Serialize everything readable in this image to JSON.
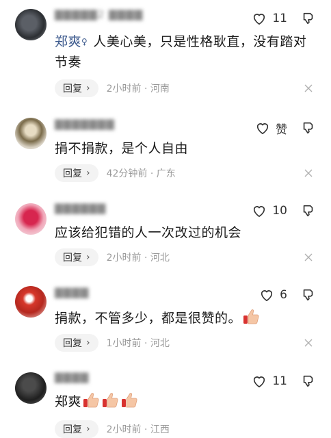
{
  "comments": [
    {
      "author": "▇▇▇▇▇2 ▇▇▇▇",
      "avatar_colors": [
        "#5b5f66",
        "#2c2f33"
      ],
      "likes": "11",
      "mention": "郑爽",
      "text": "人美心美，只是性格耿直，没有踏对节奏",
      "reply_label": "回复",
      "time": "2小时前",
      "location": "河南"
    },
    {
      "author": "▇▇▇▇▇▇▇",
      "avatar_colors": [
        "#e7dcc3",
        "#7a6b4a"
      ],
      "likes": "赞",
      "text": "捐不捐款，是个人自由",
      "reply_label": "回复",
      "time": "42分钟前",
      "location": "广东"
    },
    {
      "author": "▇▇▇▇▇▇",
      "avatar_colors": [
        "#d7264f",
        "#f0a6b8"
      ],
      "likes": "10",
      "text": "应该给犯错的人一次改过的机会",
      "reply_label": "回复",
      "time": "2小时前",
      "location": "河北"
    },
    {
      "author": "▇▇▇▇",
      "avatar_colors": [
        "#d6372b",
        "#b5281f"
      ],
      "likes": "6",
      "text": "捐款，不管多少，都是很赞的。",
      "reply_label": "回复",
      "time": "1小时前",
      "location": "河北"
    },
    {
      "author": "▇▇▇▇",
      "avatar_colors": [
        "#4b4b4b",
        "#1f1f1f"
      ],
      "likes": "11",
      "text": "郑爽",
      "reply_label": "回复",
      "time": "2小时前",
      "location": "江西"
    }
  ],
  "icons": {
    "like": "heart-outline-icon",
    "dislike": "thumbs-down-outline-icon",
    "close": "close-icon",
    "emoji": "thumbs-up-emoji",
    "mention": "user-mention-icon"
  },
  "colors": {
    "mention": "#3e5b8e",
    "meta": "#9a9a9a",
    "reply_bg": "#f3f3f3"
  },
  "separator": " · "
}
